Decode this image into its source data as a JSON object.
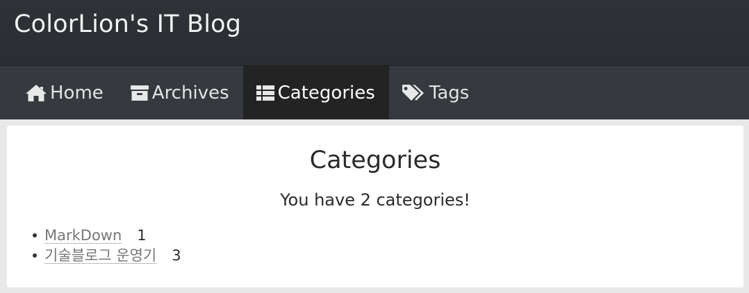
{
  "site": {
    "title": "ColorLion's IT Blog"
  },
  "nav": {
    "items": [
      {
        "label": "Home",
        "icon": "home-icon"
      },
      {
        "label": "Archives",
        "icon": "archive-icon"
      },
      {
        "label": "Categories",
        "icon": "list-icon",
        "active": true
      },
      {
        "label": "Tags",
        "icon": "tags-icon"
      }
    ]
  },
  "main": {
    "title": "Categories",
    "summary": "You have 2 categories!",
    "categories": [
      {
        "name": "MarkDown",
        "count": "1"
      },
      {
        "name": "기술블로그 운영기",
        "count": "3"
      }
    ]
  }
}
